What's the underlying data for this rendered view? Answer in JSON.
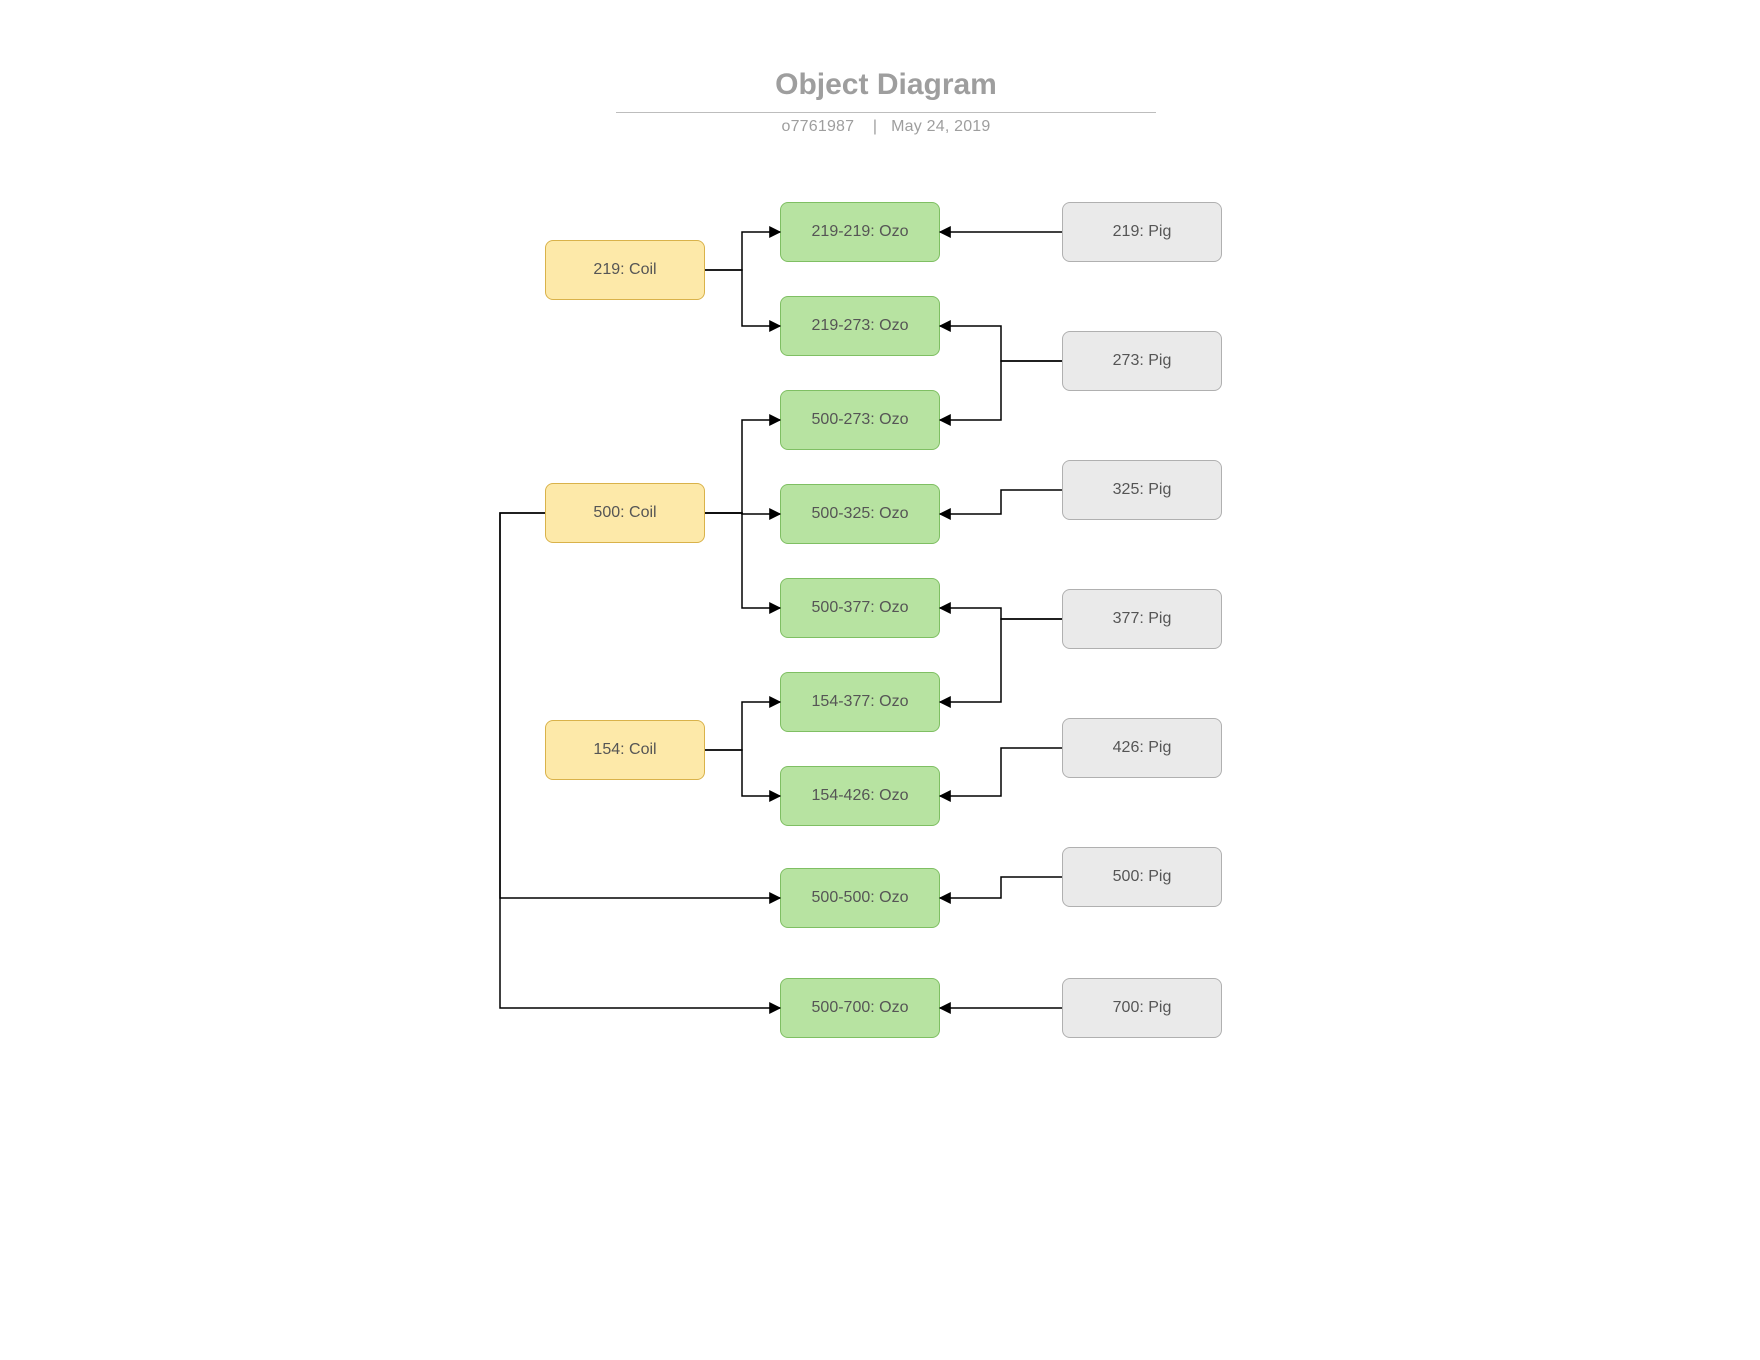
{
  "header": {
    "title": "Object Diagram",
    "id": "o7761987",
    "sep": "|",
    "date": "May 24, 2019"
  },
  "coils": [
    {
      "label": "219: Coil"
    },
    {
      "label": "500: Coil"
    },
    {
      "label": "154: Coil"
    }
  ],
  "ozos": [
    {
      "label": "219-219: Ozo"
    },
    {
      "label": "219-273: Ozo"
    },
    {
      "label": "500-273: Ozo"
    },
    {
      "label": "500-325: Ozo"
    },
    {
      "label": "500-377: Ozo"
    },
    {
      "label": "154-377: Ozo"
    },
    {
      "label": "154-426: Ozo"
    },
    {
      "label": "500-500: Ozo"
    },
    {
      "label": "500-700: Ozo"
    }
  ],
  "pigs": [
    {
      "label": "219: Pig"
    },
    {
      "label": "273: Pig"
    },
    {
      "label": "325: Pig"
    },
    {
      "label": "377: Pig"
    },
    {
      "label": "426: Pig"
    },
    {
      "label": "500: Pig"
    },
    {
      "label": "700: Pig"
    }
  ]
}
